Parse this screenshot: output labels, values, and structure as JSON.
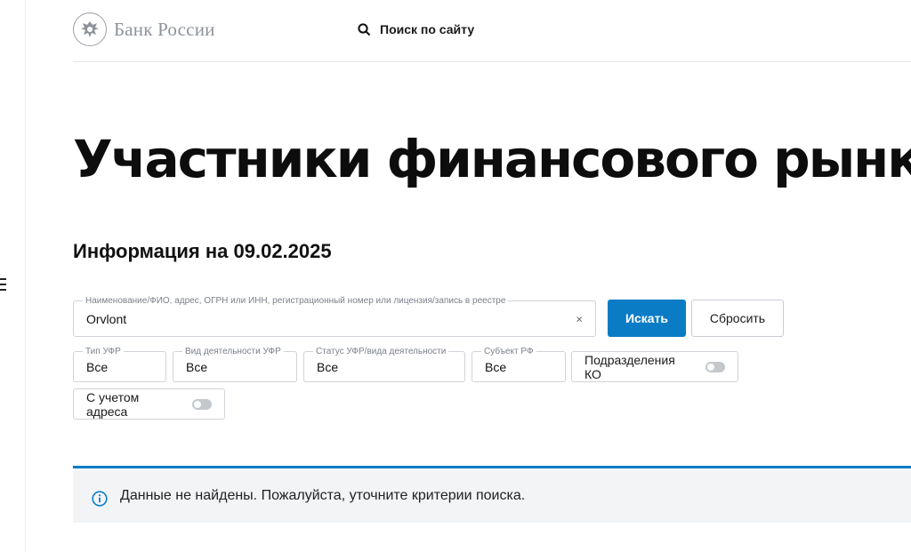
{
  "header": {
    "logo_text": "Банк России",
    "search_label": "Поиск по сайту"
  },
  "page": {
    "title": "Участники финансового рынка",
    "info_date": "Информация на 09.02.2025"
  },
  "search": {
    "main_label": "Наименование/ФИО, адрес, ОГРН или ИНН, регистрационный номер или лицензия/запись в реестре",
    "main_value": "Orvlont",
    "clear_symbol": "×",
    "submit_label": "Искать",
    "reset_label": "Сбросить"
  },
  "filters": {
    "type": {
      "label": "Тип УФР",
      "value": "Все"
    },
    "activity": {
      "label": "Вид деятельности УФР",
      "value": "Все"
    },
    "status": {
      "label": "Статус УФР/вида деятельности",
      "value": "Все"
    },
    "subject": {
      "label": "Субъект РФ",
      "value": "Все"
    },
    "branches_toggle": {
      "label": "Подразделения КО",
      "on": false
    },
    "address_toggle": {
      "label": "С учетом адреса",
      "on": false
    }
  },
  "notice": {
    "text": "Данные не найдены. Пожалуйста, уточните критерии поиска."
  },
  "colors": {
    "accent": "#0a7cc6",
    "notice_bg": "#f2f4f6",
    "logo_gray": "#8d939b"
  }
}
